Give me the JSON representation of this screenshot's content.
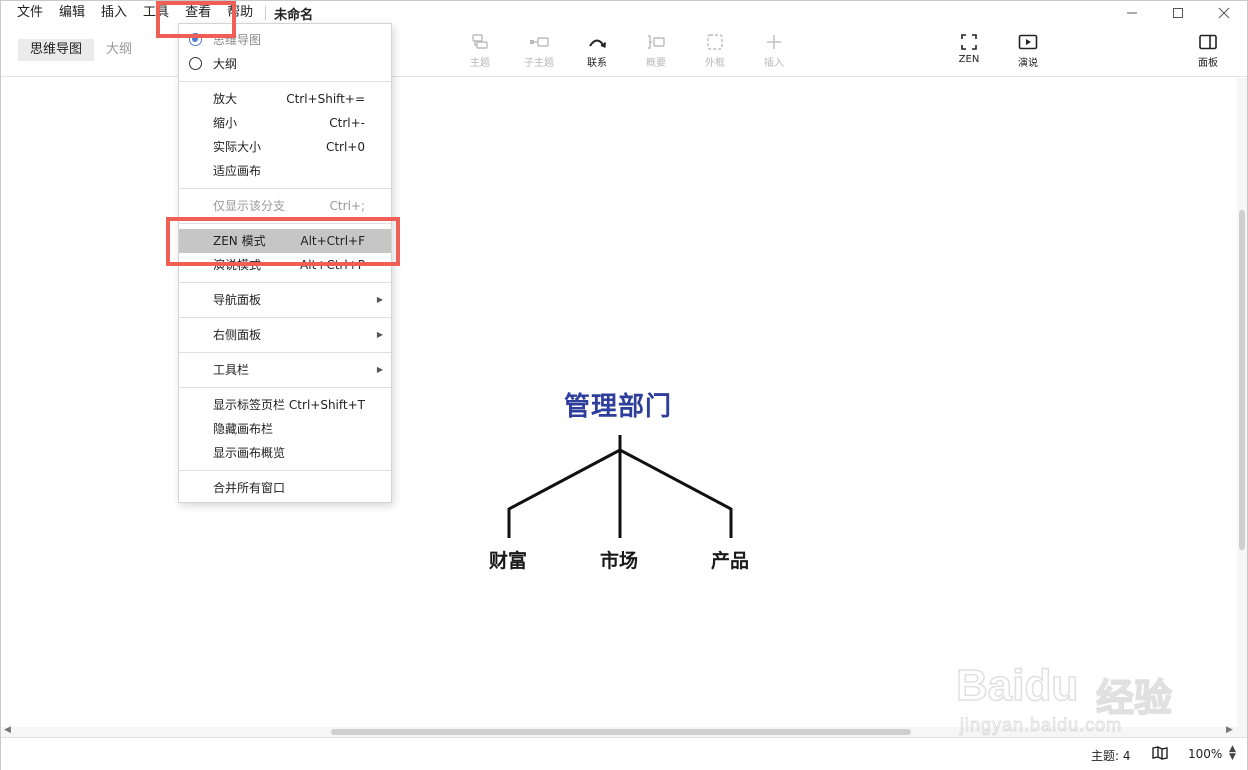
{
  "menubar": {
    "items": [
      "文件",
      "编辑",
      "插入",
      "工具",
      "查看",
      "帮助"
    ],
    "doc_title": "未命名"
  },
  "viewtabs": [
    "思维导图",
    "大纲"
  ],
  "toolbar": {
    "topic": "主题",
    "subtopic": "子主题",
    "relation": "联系",
    "summary": "概要",
    "boundary": "外框",
    "insert": "插入",
    "zen": "ZEN",
    "present": "演说",
    "panel": "面板"
  },
  "mindmap": {
    "root": "管理部门",
    "children": [
      "财富",
      "市场",
      "产品"
    ],
    "root_color": "#2d3e9b"
  },
  "menu": {
    "view_mindmap": "思维导图",
    "view_outline": "大纲",
    "zoom_in": "放大",
    "zoom_in_sc": "Ctrl+Shift+=",
    "zoom_out": "缩小",
    "zoom_out_sc": "Ctrl+-",
    "actual_size": "实际大小",
    "actual_size_sc": "Ctrl+0",
    "fit_canvas": "适应画布",
    "show_branch": "仅显示该分支",
    "show_branch_sc": "Ctrl+;",
    "zen_mode": "ZEN 模式",
    "zen_mode_sc": "Alt+Ctrl+F",
    "present_mode": "演说模式",
    "present_mode_sc": "Alt+Ctrl+P",
    "nav_panel": "导航面板",
    "right_panel": "右侧面板",
    "toolbar": "工具栏",
    "show_tabbar": "显示标签页栏",
    "show_tabbar_sc": "Ctrl+Shift+T",
    "hide_canvasbar": "隐藏画布栏",
    "show_overview": "显示画布概览",
    "merge_windows": "合并所有窗口"
  },
  "status": {
    "topics": "主题: 4",
    "zoom": "100%"
  },
  "watermark": {
    "logo": "Baidu",
    "text": "经验",
    "url": "jingyan.baidu.com"
  },
  "colors": {
    "highlight_box": "#ef5f55",
    "accent": "#4b7cd0"
  }
}
